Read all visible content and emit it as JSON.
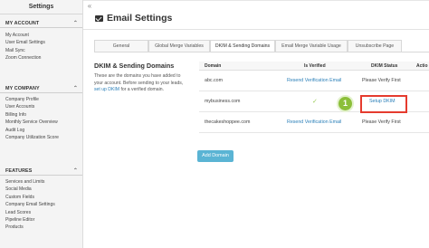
{
  "sidebar": {
    "title": "Settings",
    "sections": [
      {
        "heading": "MY ACCOUNT",
        "items": [
          "My Account",
          "User Email Settings",
          "Mail Sync",
          "Zoom Connection"
        ]
      },
      {
        "heading": "MY COMPANY",
        "items": [
          "Company Profile",
          "User Accounts",
          "Billing Info",
          "Monthly Service Overview",
          "Audit Log",
          "Company Utilization Score"
        ]
      },
      {
        "heading": "FEATURES",
        "items": [
          "Services and Limits",
          "Social Media",
          "Custom Fields",
          "Company Email Settings",
          "Lead Scores",
          "Pipeline Editor",
          "Products"
        ]
      }
    ]
  },
  "collapse_glyph": "«",
  "page": {
    "title": "Email Settings",
    "title_icon": "envelope-icon"
  },
  "tabs": [
    {
      "label": "General",
      "active": false
    },
    {
      "label": "Global Merge Variables",
      "active": false
    },
    {
      "label": "DKIM & Sending Domains",
      "active": true
    },
    {
      "label": "Email Merge Variable Usage",
      "active": false
    },
    {
      "label": "Unsubscribe Page",
      "active": false
    }
  ],
  "dkim": {
    "heading": "DKIM & Sending Domains",
    "desc_before": "These are the domains you have added to your account. Before sending to your leads, ",
    "desc_link": "set up DKIM",
    "desc_after": " for a verified domain."
  },
  "table": {
    "headers": {
      "domain": "Domain",
      "verified": "Is Verified",
      "status": "DKIM Status",
      "action": "Actio"
    },
    "rows": [
      {
        "domain": "abc.com",
        "verified": "Resend Verification Email",
        "status": "Please Verify First"
      },
      {
        "domain": "mybusiness.com",
        "verified": "✓",
        "status": "Setup DKIM"
      },
      {
        "domain": "thecakeshoppee.com",
        "verified": "Resend Verification Email",
        "status": "Please Verify First"
      }
    ]
  },
  "annotation": {
    "step": "1",
    "highlight_color": "#e53b2e",
    "badge_color": "#8cbf3a"
  },
  "add_domain_label": "Add Domain"
}
